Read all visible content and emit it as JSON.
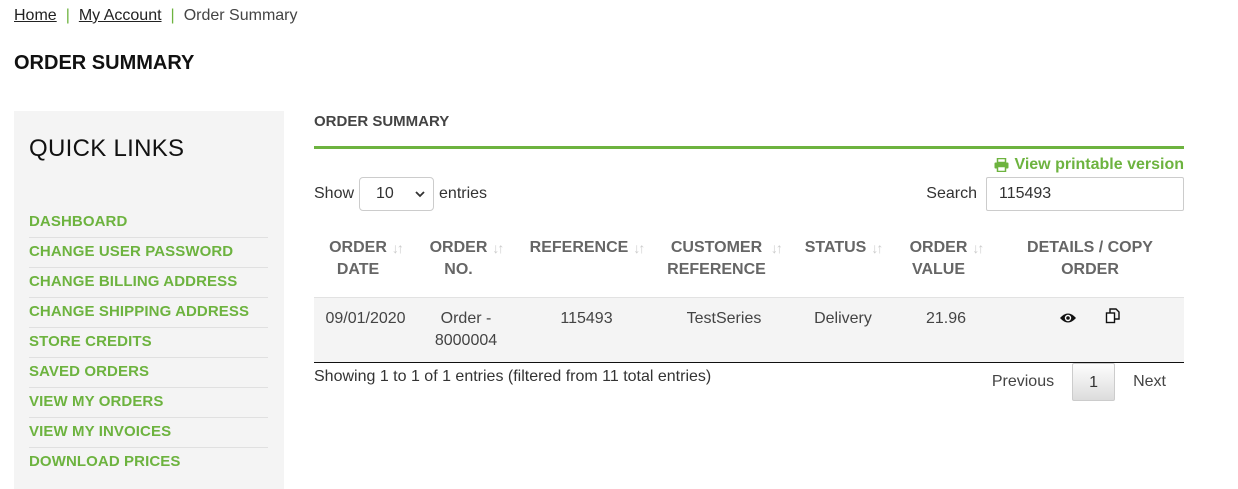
{
  "breadcrumb": {
    "home": "Home",
    "separator": "|",
    "account": "My Account",
    "current": "Order Summary"
  },
  "page_title": "ORDER SUMMARY",
  "sidebar": {
    "title": "QUICK LINKS",
    "items": [
      {
        "label": "DASHBOARD"
      },
      {
        "label": "CHANGE USER PASSWORD"
      },
      {
        "label": "CHANGE BILLING ADDRESS"
      },
      {
        "label": "CHANGE SHIPPING ADDRESS"
      },
      {
        "label": "STORE CREDITS"
      },
      {
        "label": "SAVED ORDERS"
      },
      {
        "label": "VIEW MY ORDERS"
      },
      {
        "label": "VIEW MY INVOICES"
      },
      {
        "label": "DOWNLOAD PRICES"
      }
    ]
  },
  "main": {
    "section_title": "ORDER SUMMARY",
    "print_link": "View printable version",
    "show_label": "Show",
    "entries_select": "10",
    "entries_label": "entries",
    "search_label": "Search",
    "search_value": "115493",
    "columns": [
      {
        "line1": "ORDER",
        "line2": "DATE",
        "sortable": true
      },
      {
        "line1": "ORDER",
        "line2": "NO.",
        "sortable": true
      },
      {
        "line1": "REFERENCE",
        "line2": "",
        "sortable": true
      },
      {
        "line1": "CUSTOMER",
        "line2": "REFERENCE",
        "sortable": true
      },
      {
        "line1": "STATUS",
        "line2": "",
        "sortable": true
      },
      {
        "line1": "ORDER",
        "line2": "VALUE",
        "sortable": true
      },
      {
        "line1": "DETAILS / COPY",
        "line2": "ORDER",
        "sortable": false
      }
    ],
    "rows": [
      {
        "date": "09/01/2020",
        "order_no_line1": "Order -",
        "order_no_line2": "8000004",
        "reference": "115493",
        "customer_reference": "TestSeries",
        "status": "Delivery",
        "value": "21.96",
        "details_icon": "eye-icon",
        "copy_icon": "copy-icon"
      }
    ],
    "info": "Showing 1 to 1 of 1 entries (filtered from 11 total entries)",
    "pagination": {
      "previous": "Previous",
      "current": "1",
      "next": "Next"
    }
  },
  "colors": {
    "accent": "#6db33f",
    "sidebar_bg": "#f4f4f4"
  }
}
